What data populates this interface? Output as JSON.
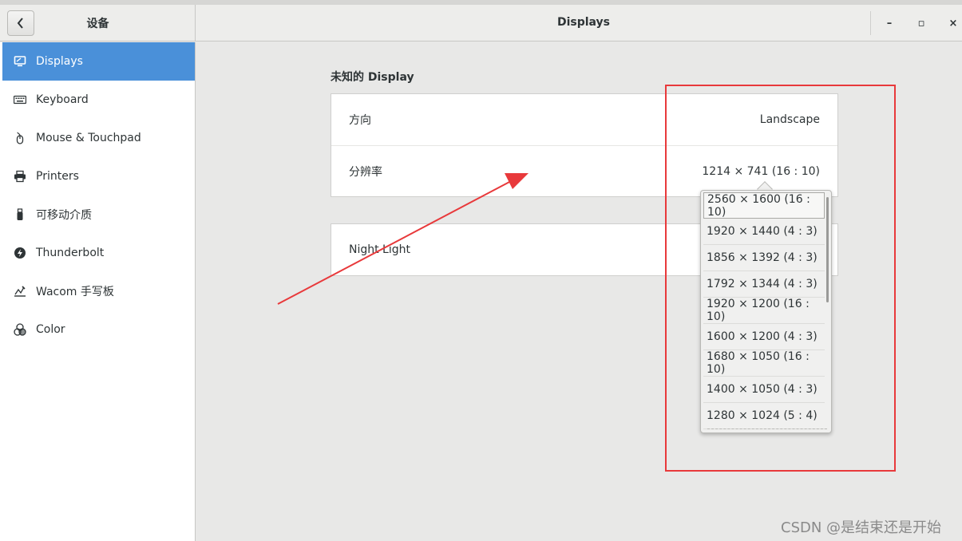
{
  "header": {
    "left_title": "设备",
    "title": "Displays",
    "minimize_glyph": "–",
    "maximize_glyph": "▫",
    "close_glyph": "×"
  },
  "sidebar": {
    "items": [
      {
        "label": "Displays",
        "icon": "display-icon"
      },
      {
        "label": "Keyboard",
        "icon": "keyboard-icon"
      },
      {
        "label": "Mouse & Touchpad",
        "icon": "mouse-icon"
      },
      {
        "label": "Printers",
        "icon": "printer-icon"
      },
      {
        "label": "可移动介质",
        "icon": "usb-drive-icon"
      },
      {
        "label": "Thunderbolt",
        "icon": "thunderbolt-icon"
      },
      {
        "label": "Wacom 手写板",
        "icon": "tablet-icon"
      },
      {
        "label": "Color",
        "icon": "color-icon"
      }
    ],
    "selected_index": 0
  },
  "display": {
    "section_title": "未知的  Display",
    "orientation_label": "方向",
    "orientation_value": "Landscape",
    "resolution_label": "分辨率",
    "resolution_value": "1214 × 741 (16 : 10)",
    "night_light_label": "Night Light"
  },
  "resolution_options": [
    "2560 × 1600 (16 : 10)",
    "1920 × 1440 (4 : 3)",
    "1856 × 1392 (4 : 3)",
    "1792 × 1344 (4 : 3)",
    "1920 × 1200 (16 : 10)",
    "1600 × 1200 (4 : 3)",
    "1680 × 1050 (16 : 10)",
    "1400 × 1050 (4 : 3)",
    "1280 × 1024 (5 : 4)"
  ],
  "annotation": {
    "color": "#e8393b"
  },
  "watermark": "CSDN @是结束还是开始",
  "colors": {
    "accent": "#4a90d9"
  }
}
